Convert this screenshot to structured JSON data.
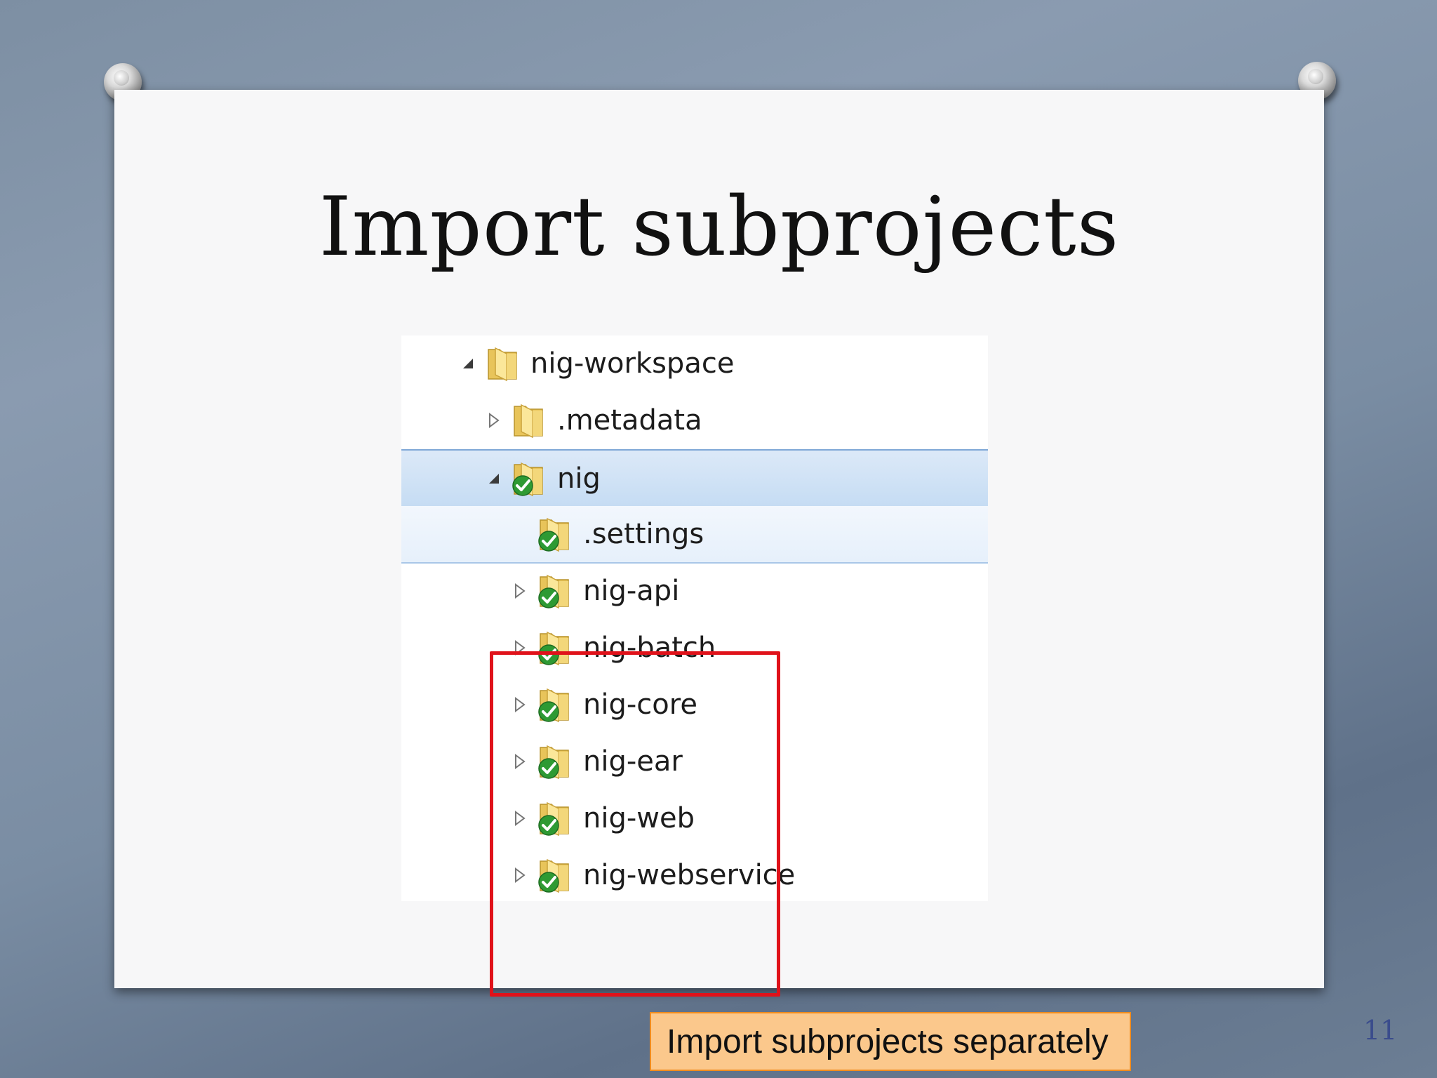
{
  "slide": {
    "title": "Import subprojects",
    "caption": "Import subprojects separately",
    "page_number": "11"
  },
  "tree": {
    "items": [
      {
        "label": "nig-workspace",
        "icon": "folder-icon",
        "expander": "expanded",
        "depth": 0
      },
      {
        "label": ".metadata",
        "icon": "folder-icon",
        "expander": "collapsed",
        "depth": 1
      },
      {
        "label": "nig",
        "icon": "project-folder-icon",
        "expander": "expanded",
        "depth": 1,
        "selected": true
      },
      {
        "label": ".settings",
        "icon": "project-folder-icon",
        "expander": "none",
        "depth": 2
      },
      {
        "label": "nig-api",
        "icon": "project-folder-icon",
        "expander": "collapsed",
        "depth": 2
      },
      {
        "label": "nig-batch",
        "icon": "project-folder-icon",
        "expander": "collapsed",
        "depth": 2
      },
      {
        "label": "nig-core",
        "icon": "project-folder-icon",
        "expander": "collapsed",
        "depth": 2
      },
      {
        "label": "nig-ear",
        "icon": "project-folder-icon",
        "expander": "collapsed",
        "depth": 2
      },
      {
        "label": "nig-web",
        "icon": "project-folder-icon",
        "expander": "collapsed",
        "depth": 2
      },
      {
        "label": "nig-webservice",
        "icon": "project-folder-icon",
        "expander": "collapsed",
        "depth": 2
      }
    ]
  },
  "colors": {
    "highlight_box": "#e0121a",
    "caption_fill": "#fbc88c",
    "caption_border": "#f08c1e",
    "selection": "#c5dcf3",
    "page_number": "#3a4c8c"
  }
}
